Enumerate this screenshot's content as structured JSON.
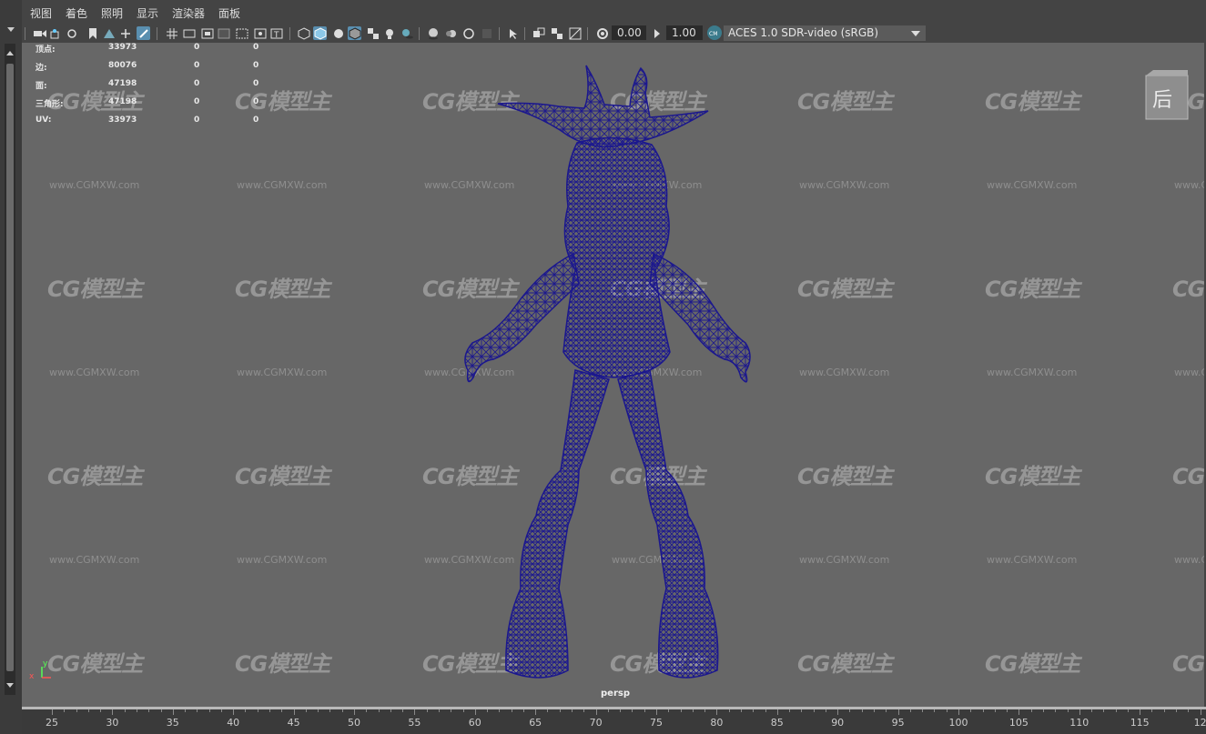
{
  "menu": [
    "视图",
    "着色",
    "照明",
    "显示",
    "渲染器",
    "面板"
  ],
  "toolbar": {
    "icons": [
      "select-camera-icon",
      "camera-attributes-icon",
      "bookmark-icon",
      "image-plane-icon",
      "2d-pan-icon",
      "grease-pencil-icon",
      "grid-icon",
      "film-gate-icon",
      "resolution-gate-icon",
      "gate-mask-icon",
      "field-chart-icon",
      "safe-action-icon",
      "safe-title-icon",
      "wireframe-icon",
      "smooth-shade-icon",
      "default-material-icon",
      "shaded-wireframe-icon",
      "textured-icon",
      "use-lights-icon",
      "shadows-icon",
      "screen-space-ao-icon",
      "motion-blur-icon",
      "anti-aliasing-icon",
      "depth-of-field-icon",
      "isolate-select-icon",
      "xray-icon",
      "xray-joints-icon",
      "xray-active-icon",
      "exposure-icon",
      "gamma-icon",
      "color-management-icon"
    ],
    "exposure_value": "0.00",
    "gamma_value": "1.00",
    "color_space": "ACES 1.0 SDR-video (sRGB)"
  },
  "hud": {
    "rows": [
      {
        "label": "顶点:",
        "v1": "33973",
        "v2": "0",
        "v3": "0"
      },
      {
        "label": "边:",
        "v1": "80076",
        "v2": "0",
        "v3": "0"
      },
      {
        "label": "面:",
        "v1": "47198",
        "v2": "0",
        "v3": "0"
      },
      {
        "label": "三角形:",
        "v1": "47198",
        "v2": "0",
        "v3": "0"
      },
      {
        "label": "UV:",
        "v1": "33973",
        "v2": "0",
        "v3": "0"
      }
    ]
  },
  "viewcube_label": "后",
  "camera_label": "persp",
  "axis_labels": {
    "x": "x",
    "y": "y"
  },
  "watermark": {
    "brand": "CG模型主",
    "url": "www.CGMXW.com"
  },
  "ruler": [
    "25",
    "30",
    "35",
    "40",
    "45",
    "50",
    "55",
    "60",
    "65",
    "70",
    "75",
    "80",
    "85",
    "90",
    "95",
    "100",
    "105",
    "110",
    "115",
    "12"
  ]
}
